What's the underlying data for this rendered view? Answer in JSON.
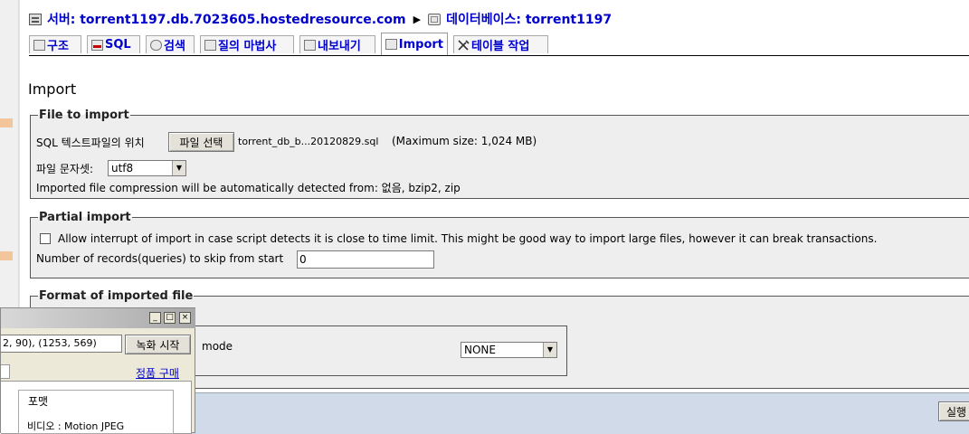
{
  "breadcrumb": {
    "server_label": "서버: torrent1197.db.7023605.hostedresource.com",
    "database_label": "데이터베이스: torrent1197"
  },
  "tabs": [
    {
      "label": "구조",
      "icon": "structure-icon"
    },
    {
      "label": "SQL",
      "icon": "sql-icon"
    },
    {
      "label": "검색",
      "icon": "search-icon"
    },
    {
      "label": "질의 마법사",
      "icon": "query-wizard-icon"
    },
    {
      "label": "내보내기",
      "icon": "export-icon"
    },
    {
      "label": "Import",
      "icon": "import-icon",
      "active": true
    },
    {
      "label": "테이블 작업",
      "icon": "operations-icon"
    }
  ],
  "page_title": "Import",
  "file_to_import": {
    "legend": "File to import",
    "file_label": "SQL 텍스트파일의 위치",
    "choose_button": "파일 선택",
    "file_name": "torrent_db_b...20120829.sql",
    "max_size": "(Maximum size: 1,024 MB)",
    "charset_label": "파일 문자셋:",
    "charset_value": "utf8",
    "compression_note": "Imported file compression will be automatically detected from: 없음, bzip2, zip"
  },
  "partial_import": {
    "legend": "Partial import",
    "allow_interrupt_label": "Allow interrupt of import in case script detects it is close to time limit. This might be good way to import large files, however it can break transactions.",
    "allow_interrupt_checked": false,
    "skip_label": "Number of records(queries) to skip from start",
    "skip_value": "0"
  },
  "format": {
    "legend": "Format of imported file",
    "mode_label": "mode",
    "mode_value": "NONE"
  },
  "run_button": "실행",
  "overlay_window": {
    "coords_value": "2, 90), (1253, 569)",
    "record_button": "녹화 시작",
    "buy_link": "정품 구매",
    "group_label": "포맷",
    "video_label": "비디오 : Motion JPEG",
    "min_btn": "_",
    "max_btn": "□",
    "close_btn": "×"
  },
  "colors": {
    "link": "#0000cc",
    "panel_bg": "#eeeeee",
    "bottom_bar": "#d0dae8"
  }
}
